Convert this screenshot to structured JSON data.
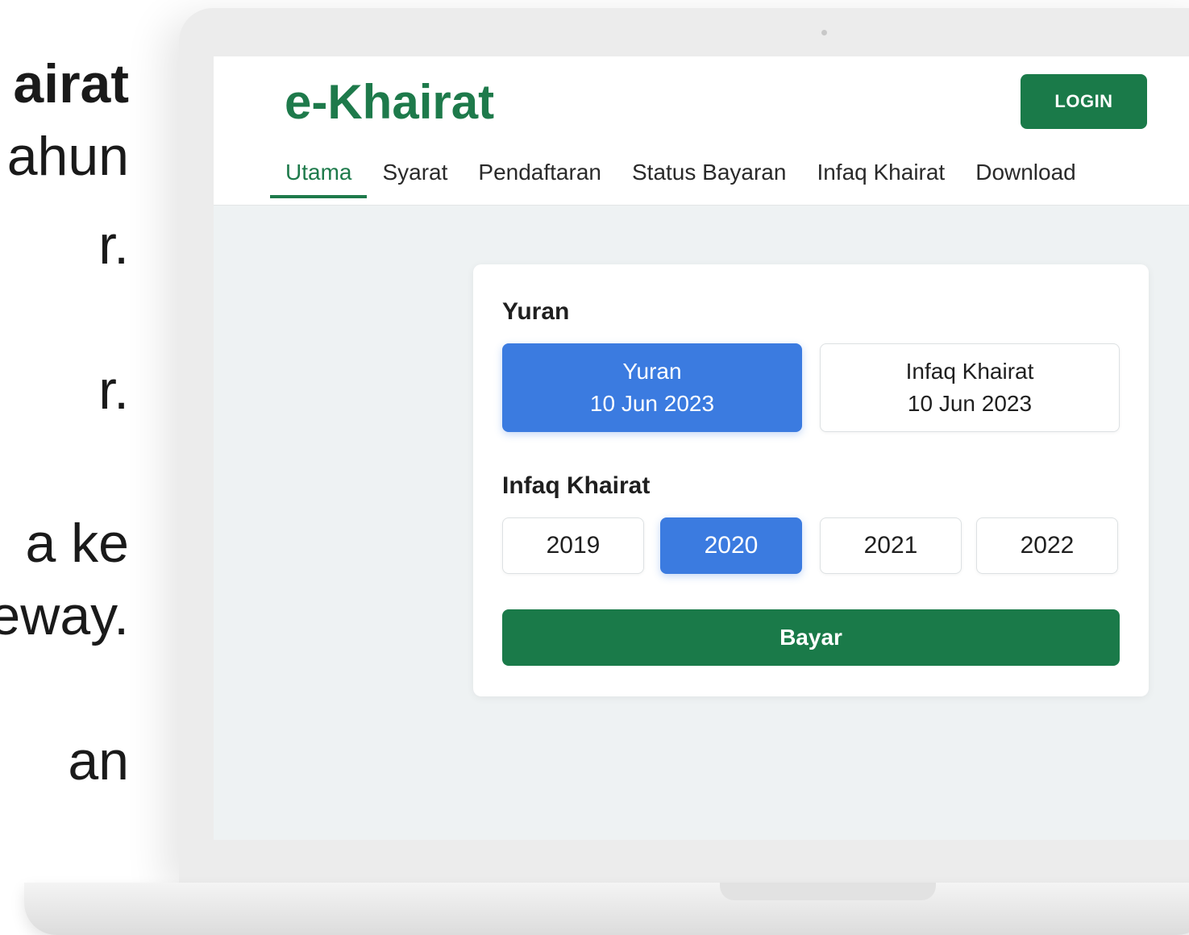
{
  "side_text": [
    "airat",
    "ahun",
    "r.",
    "r.",
    "a ke",
    "eway.",
    "an"
  ],
  "app": {
    "brand": "e-Khairat",
    "login_label": "LOGIN",
    "nav": [
      {
        "label": "Utama",
        "active": true
      },
      {
        "label": "Syarat"
      },
      {
        "label": "Pendaftaran"
      },
      {
        "label": "Status Bayaran"
      },
      {
        "label": "Infaq Khairat"
      },
      {
        "label": "Download"
      }
    ]
  },
  "form": {
    "yuran_label": "Yuran",
    "yuran_options": [
      {
        "title": "Yuran",
        "date": "10 Jun 2023",
        "selected": true
      },
      {
        "title": "Infaq Khairat",
        "date": "10 Jun 2023",
        "selected": false
      }
    ],
    "infaq_label": "Infaq Khairat",
    "years": [
      {
        "label": "2019",
        "selected": false
      },
      {
        "label": "2020",
        "selected": true
      },
      {
        "label": "2021",
        "selected": false
      },
      {
        "label": "2022",
        "selected": false
      }
    ],
    "pay_label": "Bayar"
  },
  "colors": {
    "brand_green": "#1e7a4b",
    "selected_blue": "#3b7be0",
    "button_green": "#1a7a49"
  }
}
